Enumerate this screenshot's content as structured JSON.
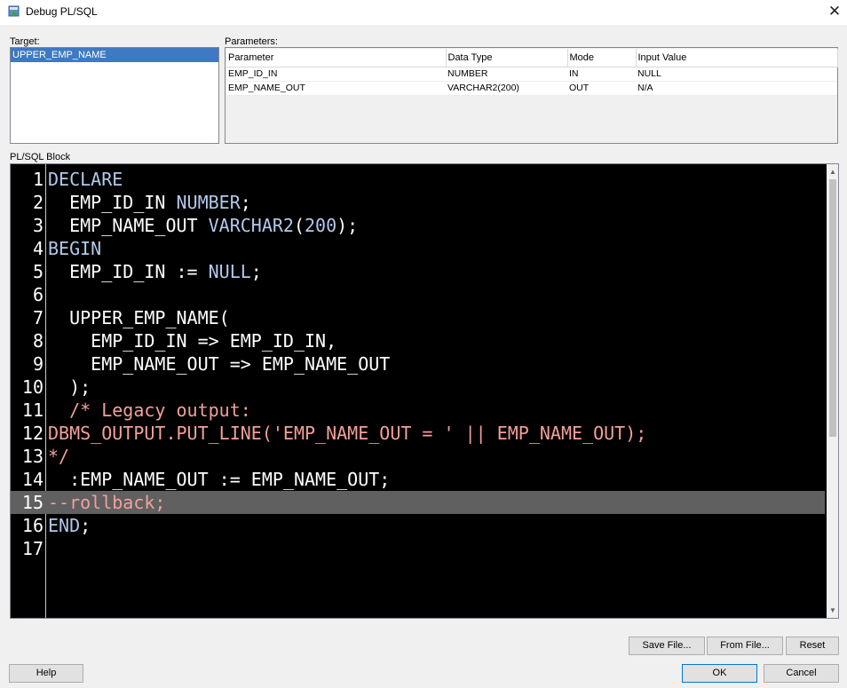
{
  "window": {
    "title": "Debug PL/SQL",
    "close_symbol": "✕"
  },
  "target": {
    "label": "Target:",
    "items": [
      "UPPER_EMP_NAME"
    ]
  },
  "parameters": {
    "label": "Parameters:",
    "columns": [
      "Parameter",
      "Data Type",
      "Mode",
      "Input Value"
    ],
    "rows": [
      [
        "EMP_ID_IN",
        "NUMBER",
        "IN",
        "NULL"
      ],
      [
        "EMP_NAME_OUT",
        "VARCHAR2(200)",
        "OUT",
        "N/A"
      ]
    ]
  },
  "plsql_block": {
    "label": "PL/SQL Block",
    "current_line": 15,
    "lines": [
      "DECLARE",
      "  EMP_ID_IN NUMBER;",
      "  EMP_NAME_OUT VARCHAR2(200);",
      "BEGIN",
      "  EMP_ID_IN := NULL;",
      "",
      "  UPPER_EMP_NAME(",
      "    EMP_ID_IN => EMP_ID_IN,",
      "    EMP_NAME_OUT => EMP_NAME_OUT",
      "  );",
      "  /* Legacy output:",
      "DBMS_OUTPUT.PUT_LINE('EMP_NAME_OUT = ' || EMP_NAME_OUT);",
      "*/",
      "  :EMP_NAME_OUT := EMP_NAME_OUT;",
      "--rollback;",
      "END;",
      ""
    ]
  },
  "buttons": {
    "save_file": "Save File...",
    "from_file": "From File...",
    "reset": "Reset",
    "help": "Help",
    "ok": "OK",
    "cancel": "Cancel"
  },
  "colors": {
    "editor_background": "#000000",
    "keyword": "#b4c8ea",
    "comment": "#f2a09a",
    "selection": "#3e79c2"
  }
}
